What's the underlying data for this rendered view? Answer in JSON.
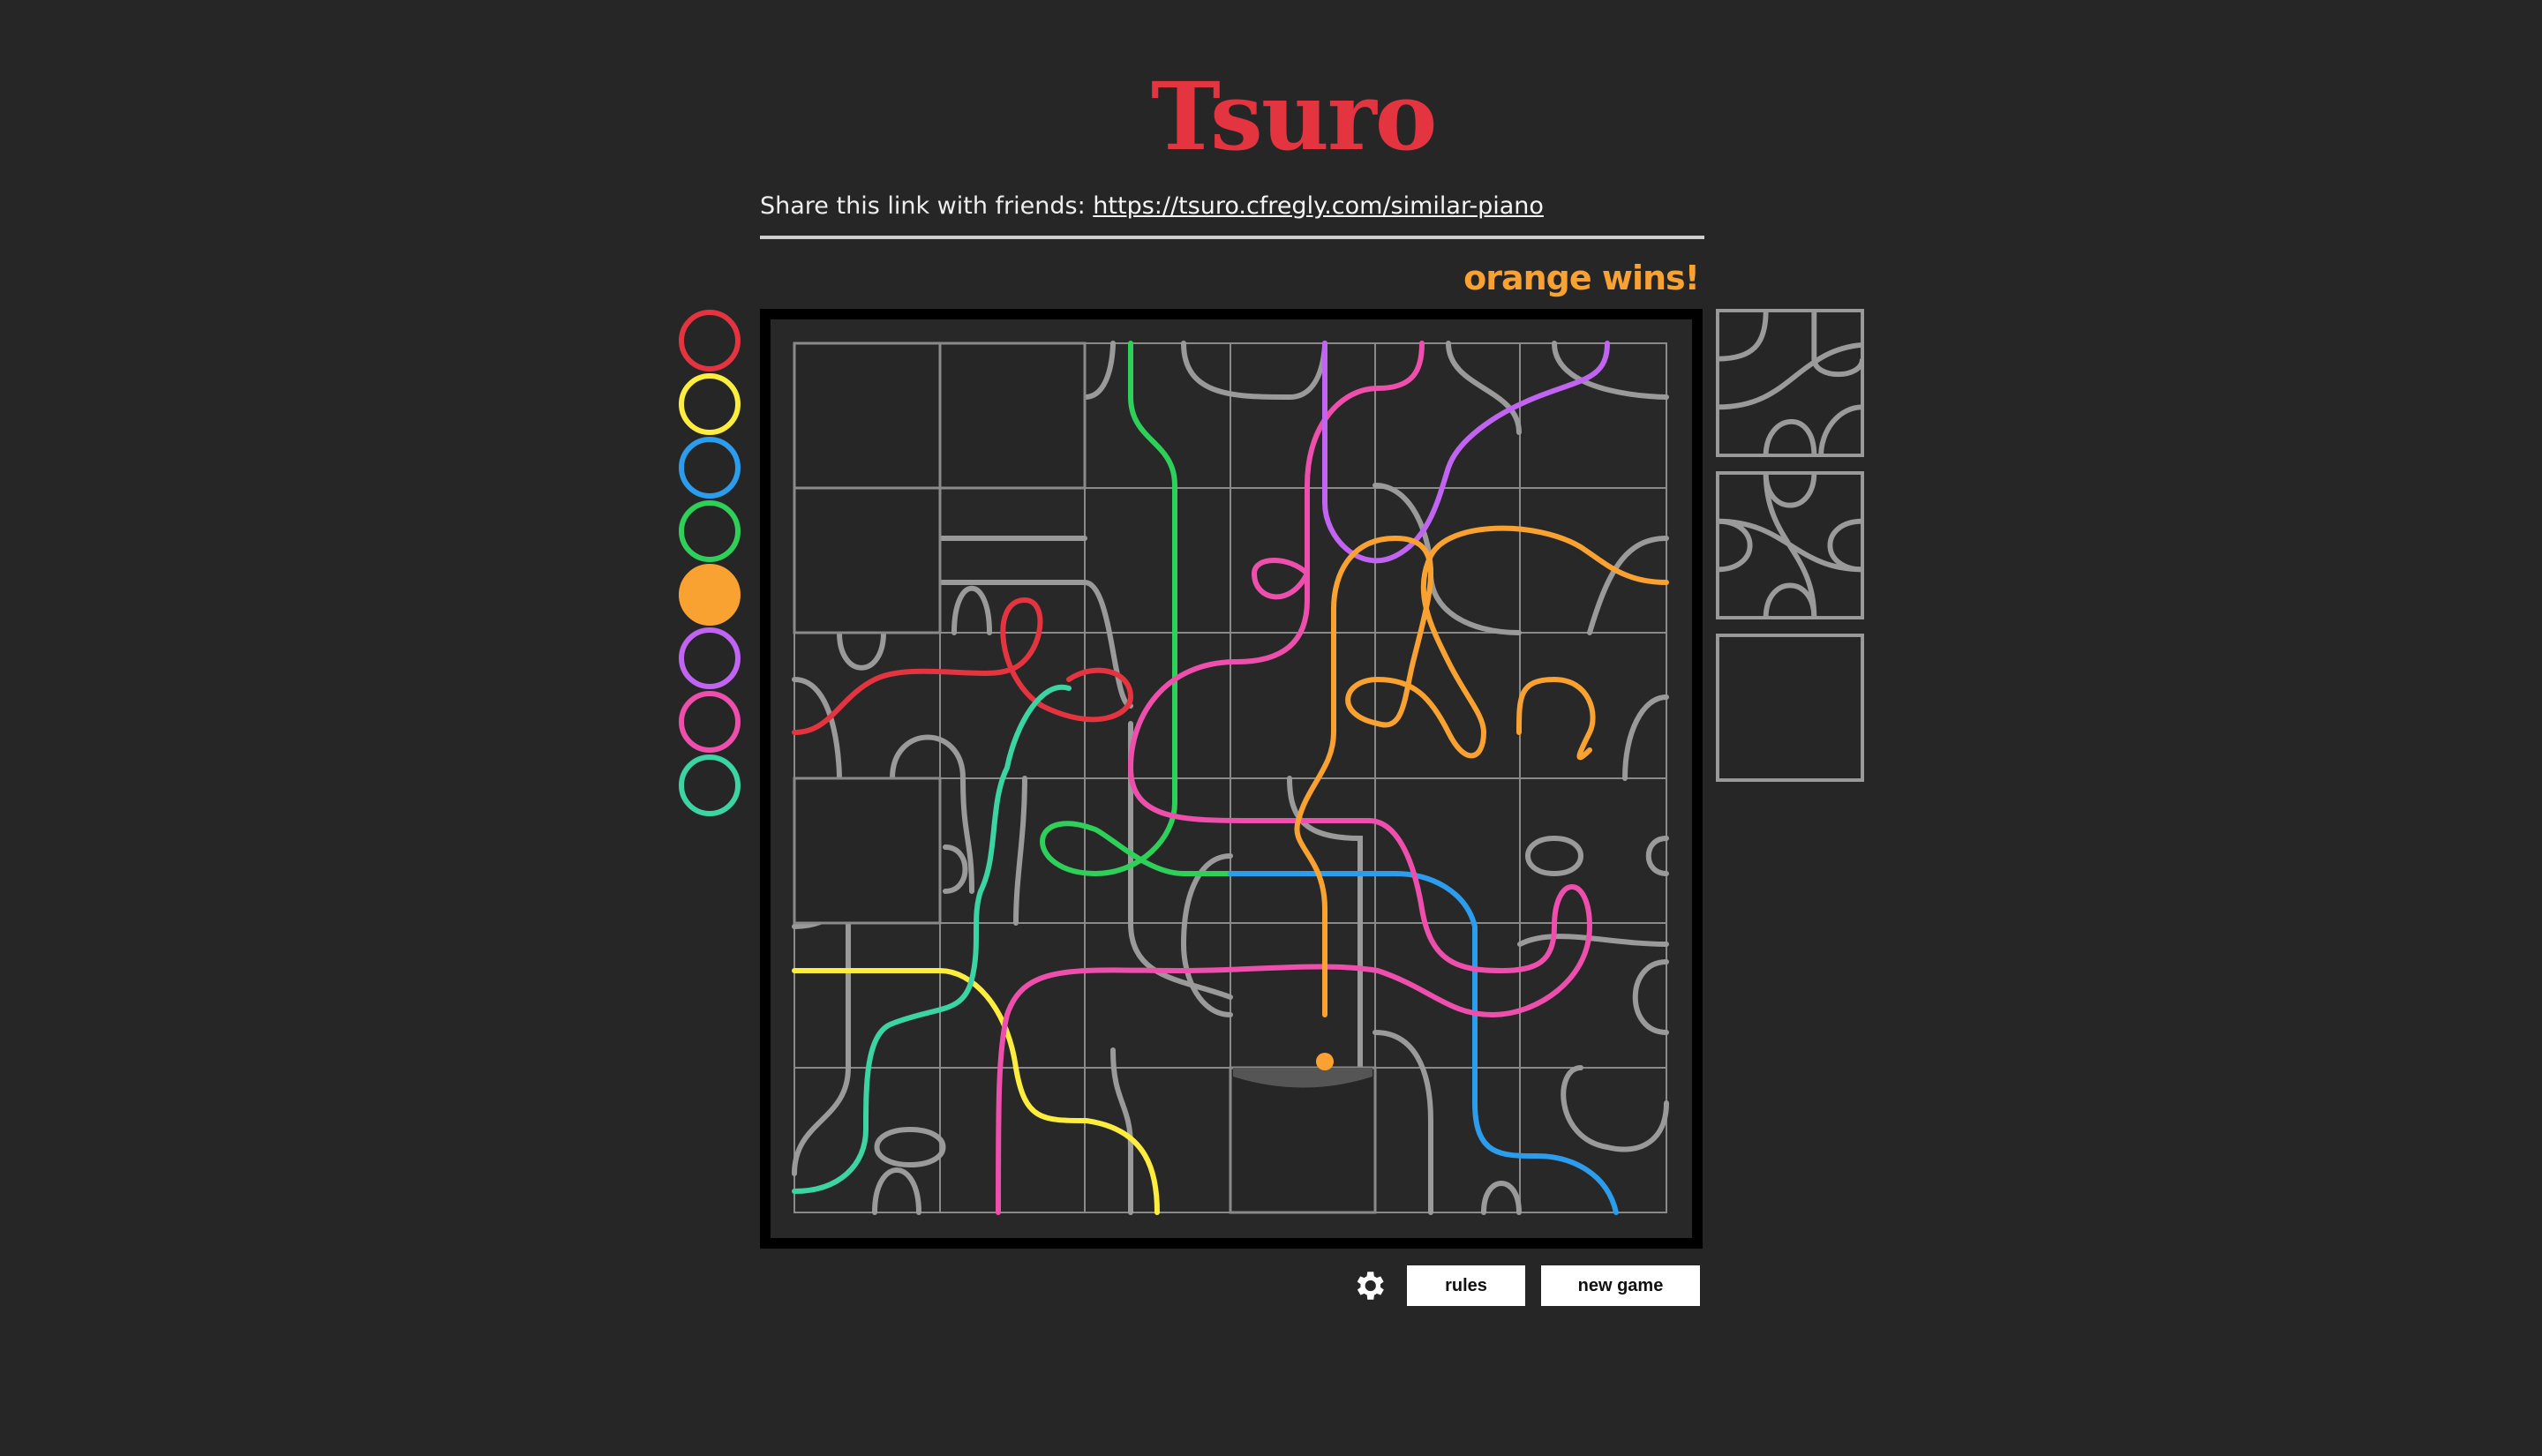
{
  "header": {
    "title": "Tsuro"
  },
  "share": {
    "label": "Share this link with friends:",
    "link": "https://tsuro.cfregly.com/similar-piano"
  },
  "status": {
    "text": "orange wins!",
    "color": "#f9a232"
  },
  "players": [
    {
      "color": "red",
      "hex": "#e3343f",
      "active": false
    },
    {
      "color": "yellow",
      "hex": "#fced3f",
      "active": false
    },
    {
      "color": "blue",
      "hex": "#2c9ded",
      "active": false
    },
    {
      "color": "green",
      "hex": "#2ed05a",
      "active": false
    },
    {
      "color": "orange",
      "hex": "#f9a232",
      "active": true
    },
    {
      "color": "purple",
      "hex": "#c064f1",
      "active": false
    },
    {
      "color": "pink",
      "hex": "#ee4fad",
      "active": false
    },
    {
      "color": "teal",
      "hex": "#3cd4a2",
      "active": false
    }
  ],
  "board": {
    "rows": 6,
    "cols": 6,
    "empty_cells": [
      [
        0,
        0
      ],
      [
        0,
        1
      ],
      [
        1,
        0
      ],
      [
        3,
        0
      ],
      [
        6,
        3
      ]
    ],
    "winner_marker": "orange-token"
  },
  "hand": {
    "tiles": [
      "curves-tile",
      "cross-curves-tile",
      "empty-slot"
    ]
  },
  "controls": {
    "rules_label": "rules",
    "new_game_label": "new game",
    "settings_icon": "gear-icon"
  }
}
